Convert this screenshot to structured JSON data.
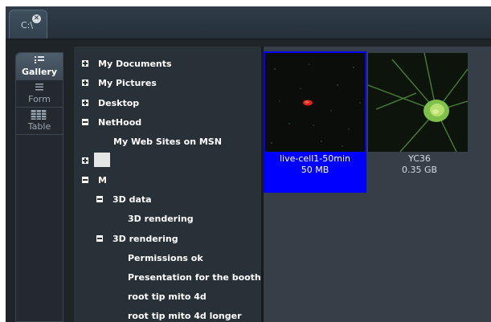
{
  "window": {
    "tab_label": "C:\\",
    "tab_close_glyph": "✕"
  },
  "view_tabs": [
    {
      "label": "Gallery",
      "icon": "gallery-icon",
      "active": true
    },
    {
      "label": "Form",
      "icon": "form-icon",
      "active": false
    },
    {
      "label": "Table",
      "icon": "table-icon",
      "active": false
    }
  ],
  "tree": {
    "items": [
      {
        "label": "My Documents",
        "state": "collapsed"
      },
      {
        "label": "My Pictures",
        "state": "collapsed"
      },
      {
        "label": "Desktop",
        "state": "collapsed"
      },
      {
        "label": "NetHood",
        "state": "expanded"
      },
      {
        "label": "My Web Sites on MSN",
        "state": "leaf"
      },
      {
        "label": "",
        "state": "collapsed"
      },
      {
        "label": "M",
        "state": "expanded"
      },
      {
        "label": "3D data",
        "state": "expanded"
      },
      {
        "label": "3D rendering",
        "state": "leaf"
      },
      {
        "label": "3D rendering",
        "state": "expanded"
      },
      {
        "label": "Permissions ok",
        "state": "leaf"
      },
      {
        "label": "Presentation for the booth",
        "state": "leaf"
      },
      {
        "label": "root tip mito 4d",
        "state": "leaf"
      },
      {
        "label": "root tip mito 4d longer",
        "state": "leaf"
      }
    ]
  },
  "gallery": {
    "items": [
      {
        "name": "live-cell1-50min",
        "size": "50 MB",
        "selected": true
      },
      {
        "name": "YC36",
        "size": "0.35 GB",
        "selected": false
      }
    ]
  },
  "colors": {
    "selection": "#0000ff",
    "panel_bg": "#283038",
    "gallery_bg": "#363f47"
  }
}
